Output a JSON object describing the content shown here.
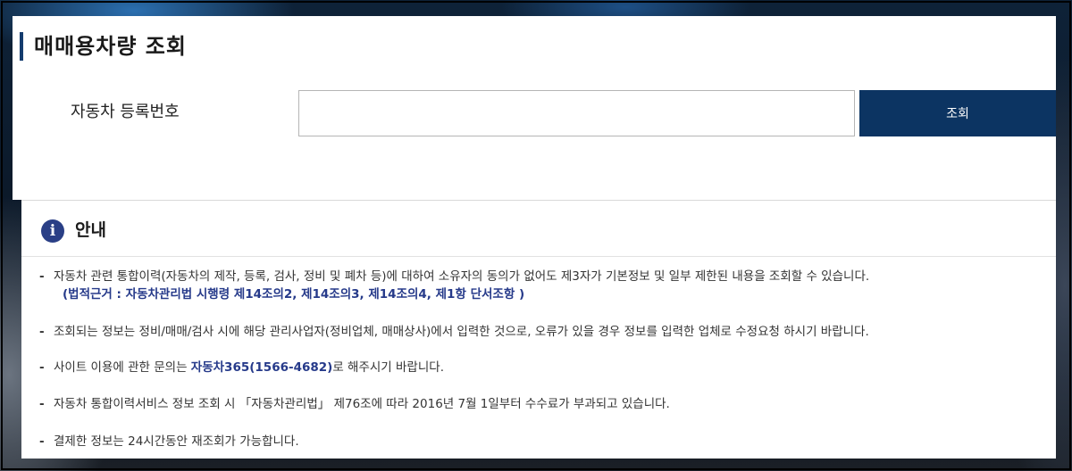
{
  "page": {
    "title": "매매용차량 조회"
  },
  "search": {
    "label": "자동차 등록번호",
    "value": "",
    "placeholder": "",
    "button_label": "조회"
  },
  "info": {
    "title": "안내",
    "icon": "info-icon",
    "notices": [
      {
        "text": "자동차 관련 통합이력(자동차의 제작, 등록, 검사, 정비 및 폐차 등)에 대하여 소유자의 동의가 없어도 제3자가 기본정보 및 일부 제한된 내용을 조회할 수 있습니다.",
        "legal_basis": "(법적근거 : 자동차관리법 시행령 제14조의2, 제14조의3, 제14조의4, 제1항 단서조항 )"
      },
      {
        "text": "조회되는 정보는 정비/매매/검사 시에 해당 관리사업자(정비업체, 매매상사)에서 입력한 것으로, 오류가 있을 경우 정보를 입력한 업체로 수정요청 하시기 바랍니다."
      },
      {
        "text_before": "사이트 이용에 관한 문의는 ",
        "highlight": "자동차365(1566-4682)",
        "text_after": "로 해주시기 바랍니다."
      },
      {
        "text": "자동차 통합이력서비스 정보 조회 시 「자동차관리법」 제76조에 따라 2016년 7월 1일부터 수수료가 부과되고 있습니다."
      },
      {
        "text": "결제한 정보는 24시간동안 재조회가 가능합니다."
      }
    ]
  },
  "colors": {
    "primary": "#0c3462",
    "accent": "#263a8a",
    "title_bar": "#143c6e"
  }
}
